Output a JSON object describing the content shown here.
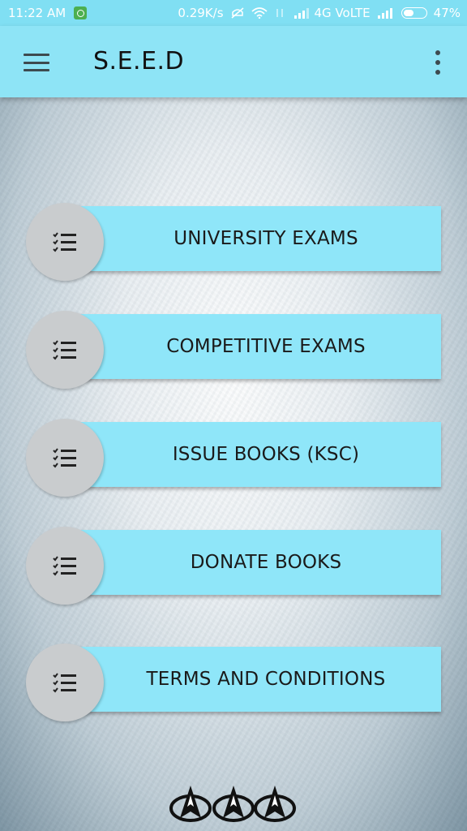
{
  "status_bar": {
    "time": "11:22 AM",
    "network_speed": "0.29K/s",
    "network_label": "4G VoLTE",
    "battery_percent": "47%",
    "battery_level": 0.47,
    "icons": [
      "alarm-icon",
      "mute-icon",
      "wifi-icon",
      "data-arrows-icon",
      "signal-icon",
      "signal-icon",
      "battery-icon"
    ]
  },
  "app_bar": {
    "title": "S.E.E.D",
    "menu_icon": "hamburger-menu-icon",
    "overflow_icon": "more-vert-icon"
  },
  "menu": {
    "items": [
      {
        "label": "UNIVERSITY EXAMS",
        "icon": "checklist-icon"
      },
      {
        "label": "COMPETITIVE EXAMS",
        "icon": "checklist-icon"
      },
      {
        "label": "ISSUE BOOKS (KSC)",
        "icon": "checklist-icon"
      },
      {
        "label": "DONATE BOOKS",
        "icon": "checklist-icon"
      },
      {
        "label": "TERMS AND CONDITIONS",
        "icon": "checklist-icon"
      }
    ]
  },
  "footer": {
    "logo_icon": "starfleet-delta-logo"
  },
  "colors": {
    "app_bar": "#8ee4f6",
    "status_bar": "#80dff3",
    "button": "#8fe6f9",
    "icon_circle": "#c9ccce",
    "text_dark": "#1a1a1a"
  }
}
